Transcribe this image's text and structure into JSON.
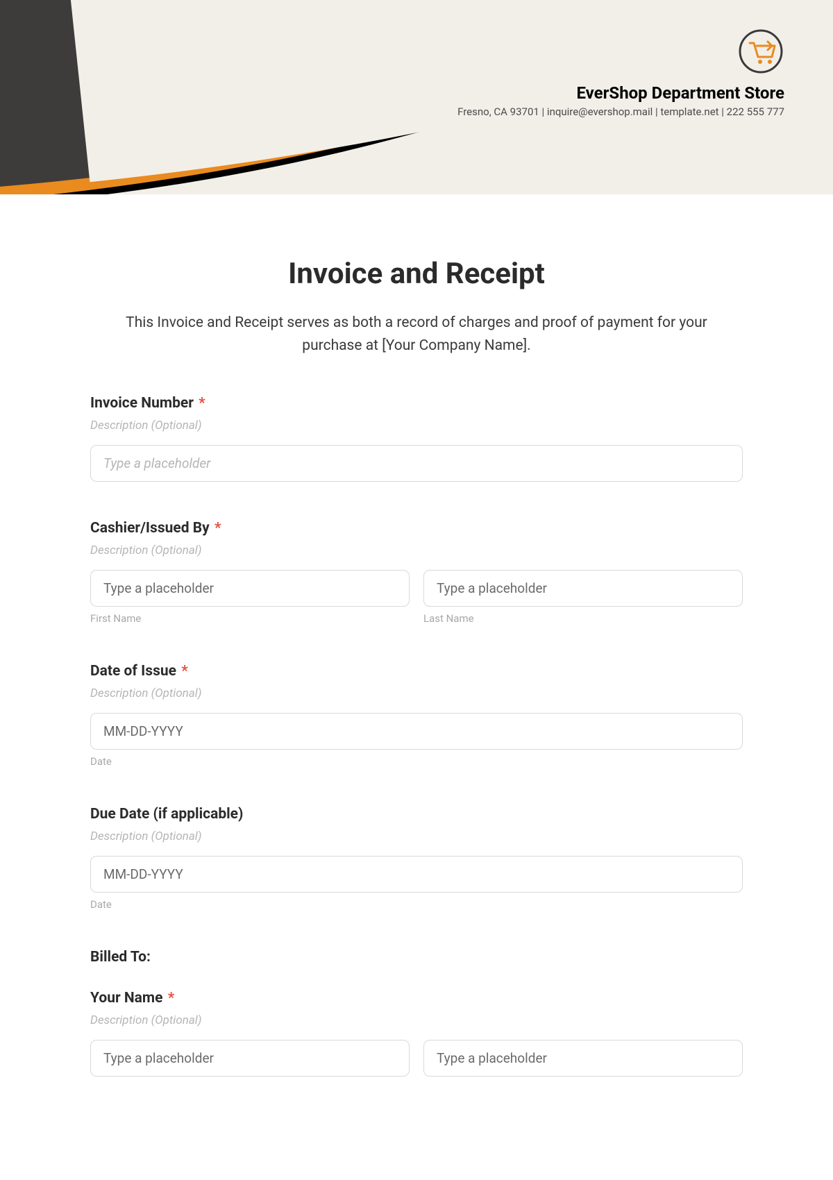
{
  "header": {
    "company_name": "EverShop Department Store",
    "contact_line": "Fresno, CA 93701 | inquire@evershop.mail | template.net | 222 555 777"
  },
  "title": "Invoice and Receipt",
  "description": "This Invoice and Receipt serves as both a record of charges and proof of payment for your purchase at [Your Company Name].",
  "fields": {
    "invoice_number": {
      "label": "Invoice Number",
      "required": "*",
      "desc": "Description (Optional)",
      "placeholder": "Type a placeholder"
    },
    "cashier": {
      "label": "Cashier/Issued By",
      "required": "*",
      "desc": "Description (Optional)",
      "first_placeholder": "Type a placeholder",
      "first_sublabel": "First Name",
      "last_placeholder": "Type a placeholder",
      "last_sublabel": "Last Name"
    },
    "date_of_issue": {
      "label": "Date of Issue",
      "required": "*",
      "desc": "Description (Optional)",
      "placeholder": "MM-DD-YYYY",
      "sublabel": "Date"
    },
    "due_date": {
      "label": "Due Date (if applicable)",
      "desc": "Description (Optional)",
      "placeholder": "MM-DD-YYYY",
      "sublabel": "Date"
    },
    "billed_to": {
      "section_label": "Billed To:"
    },
    "your_name": {
      "label": "Your Name",
      "required": "*",
      "desc": "Description (Optional)",
      "first_placeholder": "Type a placeholder",
      "last_placeholder": "Type a placeholder"
    }
  }
}
